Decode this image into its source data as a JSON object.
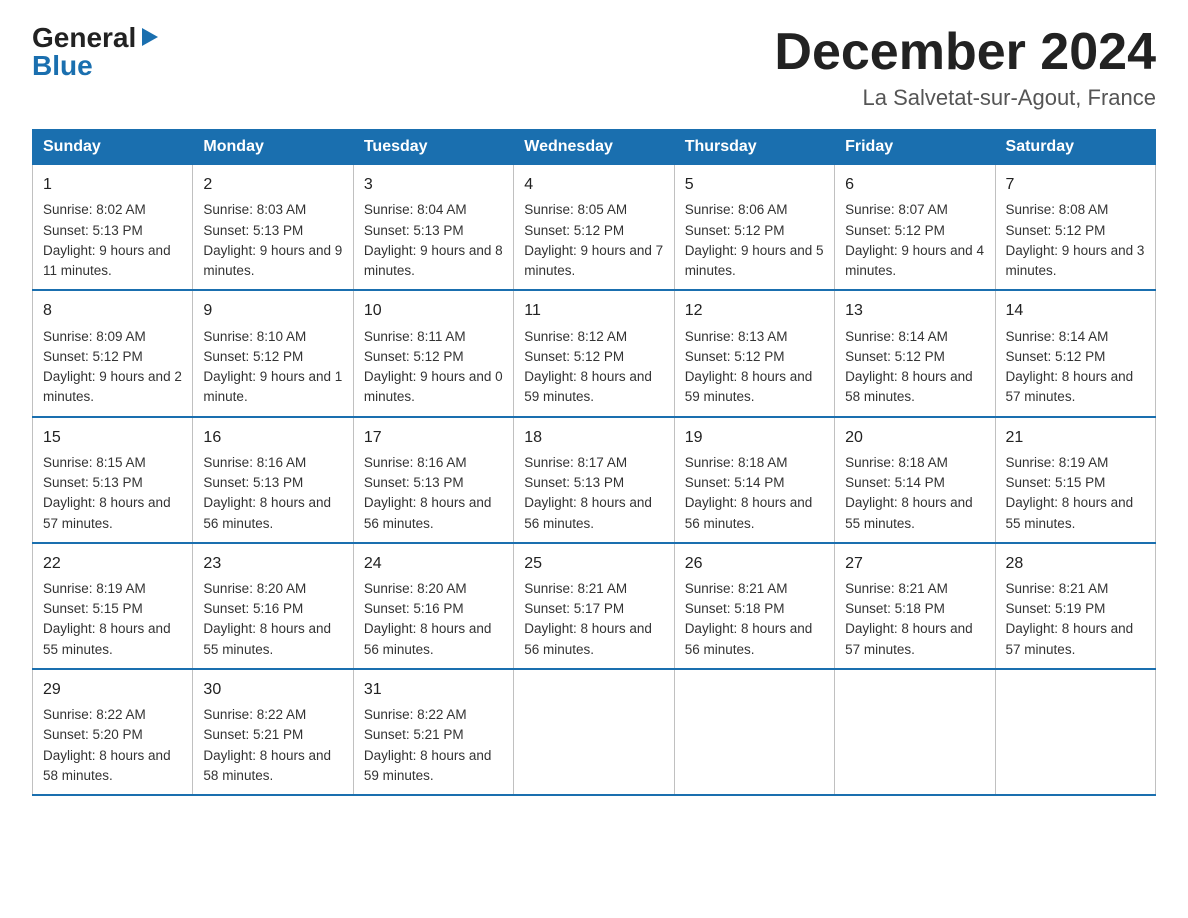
{
  "header": {
    "logo_general": "General",
    "logo_blue": "Blue",
    "month_title": "December 2024",
    "location": "La Salvetat-sur-Agout, France"
  },
  "days_of_week": [
    "Sunday",
    "Monday",
    "Tuesday",
    "Wednesday",
    "Thursday",
    "Friday",
    "Saturday"
  ],
  "weeks": [
    [
      {
        "day": "1",
        "sunrise": "8:02 AM",
        "sunset": "5:13 PM",
        "daylight": "9 hours and 11 minutes."
      },
      {
        "day": "2",
        "sunrise": "8:03 AM",
        "sunset": "5:13 PM",
        "daylight": "9 hours and 9 minutes."
      },
      {
        "day": "3",
        "sunrise": "8:04 AM",
        "sunset": "5:13 PM",
        "daylight": "9 hours and 8 minutes."
      },
      {
        "day": "4",
        "sunrise": "8:05 AM",
        "sunset": "5:12 PM",
        "daylight": "9 hours and 7 minutes."
      },
      {
        "day": "5",
        "sunrise": "8:06 AM",
        "sunset": "5:12 PM",
        "daylight": "9 hours and 5 minutes."
      },
      {
        "day": "6",
        "sunrise": "8:07 AM",
        "sunset": "5:12 PM",
        "daylight": "9 hours and 4 minutes."
      },
      {
        "day": "7",
        "sunrise": "8:08 AM",
        "sunset": "5:12 PM",
        "daylight": "9 hours and 3 minutes."
      }
    ],
    [
      {
        "day": "8",
        "sunrise": "8:09 AM",
        "sunset": "5:12 PM",
        "daylight": "9 hours and 2 minutes."
      },
      {
        "day": "9",
        "sunrise": "8:10 AM",
        "sunset": "5:12 PM",
        "daylight": "9 hours and 1 minute."
      },
      {
        "day": "10",
        "sunrise": "8:11 AM",
        "sunset": "5:12 PM",
        "daylight": "9 hours and 0 minutes."
      },
      {
        "day": "11",
        "sunrise": "8:12 AM",
        "sunset": "5:12 PM",
        "daylight": "8 hours and 59 minutes."
      },
      {
        "day": "12",
        "sunrise": "8:13 AM",
        "sunset": "5:12 PM",
        "daylight": "8 hours and 59 minutes."
      },
      {
        "day": "13",
        "sunrise": "8:14 AM",
        "sunset": "5:12 PM",
        "daylight": "8 hours and 58 minutes."
      },
      {
        "day": "14",
        "sunrise": "8:14 AM",
        "sunset": "5:12 PM",
        "daylight": "8 hours and 57 minutes."
      }
    ],
    [
      {
        "day": "15",
        "sunrise": "8:15 AM",
        "sunset": "5:13 PM",
        "daylight": "8 hours and 57 minutes."
      },
      {
        "day": "16",
        "sunrise": "8:16 AM",
        "sunset": "5:13 PM",
        "daylight": "8 hours and 56 minutes."
      },
      {
        "day": "17",
        "sunrise": "8:16 AM",
        "sunset": "5:13 PM",
        "daylight": "8 hours and 56 minutes."
      },
      {
        "day": "18",
        "sunrise": "8:17 AM",
        "sunset": "5:13 PM",
        "daylight": "8 hours and 56 minutes."
      },
      {
        "day": "19",
        "sunrise": "8:18 AM",
        "sunset": "5:14 PM",
        "daylight": "8 hours and 56 minutes."
      },
      {
        "day": "20",
        "sunrise": "8:18 AM",
        "sunset": "5:14 PM",
        "daylight": "8 hours and 55 minutes."
      },
      {
        "day": "21",
        "sunrise": "8:19 AM",
        "sunset": "5:15 PM",
        "daylight": "8 hours and 55 minutes."
      }
    ],
    [
      {
        "day": "22",
        "sunrise": "8:19 AM",
        "sunset": "5:15 PM",
        "daylight": "8 hours and 55 minutes."
      },
      {
        "day": "23",
        "sunrise": "8:20 AM",
        "sunset": "5:16 PM",
        "daylight": "8 hours and 55 minutes."
      },
      {
        "day": "24",
        "sunrise": "8:20 AM",
        "sunset": "5:16 PM",
        "daylight": "8 hours and 56 minutes."
      },
      {
        "day": "25",
        "sunrise": "8:21 AM",
        "sunset": "5:17 PM",
        "daylight": "8 hours and 56 minutes."
      },
      {
        "day": "26",
        "sunrise": "8:21 AM",
        "sunset": "5:18 PM",
        "daylight": "8 hours and 56 minutes."
      },
      {
        "day": "27",
        "sunrise": "8:21 AM",
        "sunset": "5:18 PM",
        "daylight": "8 hours and 57 minutes."
      },
      {
        "day": "28",
        "sunrise": "8:21 AM",
        "sunset": "5:19 PM",
        "daylight": "8 hours and 57 minutes."
      }
    ],
    [
      {
        "day": "29",
        "sunrise": "8:22 AM",
        "sunset": "5:20 PM",
        "daylight": "8 hours and 58 minutes."
      },
      {
        "day": "30",
        "sunrise": "8:22 AM",
        "sunset": "5:21 PM",
        "daylight": "8 hours and 58 minutes."
      },
      {
        "day": "31",
        "sunrise": "8:22 AM",
        "sunset": "5:21 PM",
        "daylight": "8 hours and 59 minutes."
      },
      null,
      null,
      null,
      null
    ]
  ],
  "labels": {
    "sunrise": "Sunrise: ",
    "sunset": "Sunset: ",
    "daylight": "Daylight: "
  }
}
